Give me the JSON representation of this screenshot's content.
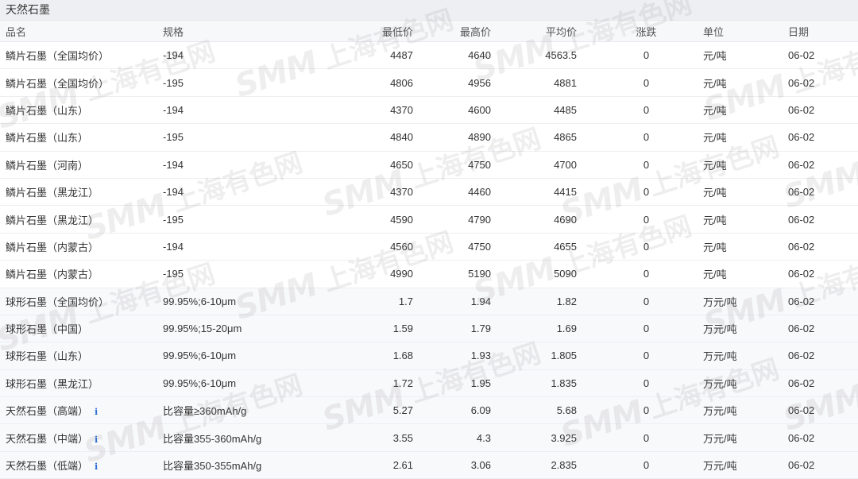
{
  "section": {
    "title": "天然石墨"
  },
  "columns": {
    "name": "品名",
    "spec": "规格",
    "min": "最低价",
    "max": "最高价",
    "avg": "平均价",
    "change": "涨跌",
    "unit": "单位",
    "date": "日期"
  },
  "rows": [
    {
      "name": "鳞片石墨（全国均价）",
      "spec": "-194",
      "min": "4487",
      "max": "4640",
      "avg": "4563.5",
      "change": "0",
      "unit": "元/吨",
      "date": "06-02"
    },
    {
      "name": "鳞片石墨（全国均价）",
      "spec": "-195",
      "min": "4806",
      "max": "4956",
      "avg": "4881",
      "change": "0",
      "unit": "元/吨",
      "date": "06-02"
    },
    {
      "name": "鳞片石墨（山东）",
      "spec": "-194",
      "min": "4370",
      "max": "4600",
      "avg": "4485",
      "change": "0",
      "unit": "元/吨",
      "date": "06-02"
    },
    {
      "name": "鳞片石墨（山东）",
      "spec": "-195",
      "min": "4840",
      "max": "4890",
      "avg": "4865",
      "change": "0",
      "unit": "元/吨",
      "date": "06-02"
    },
    {
      "name": "鳞片石墨（河南）",
      "spec": "-194",
      "min": "4650",
      "max": "4750",
      "avg": "4700",
      "change": "0",
      "unit": "元/吨",
      "date": "06-02"
    },
    {
      "name": "鳞片石墨（黑龙江）",
      "spec": "-194",
      "min": "4370",
      "max": "4460",
      "avg": "4415",
      "change": "0",
      "unit": "元/吨",
      "date": "06-02"
    },
    {
      "name": "鳞片石墨（黑龙江）",
      "spec": "-195",
      "min": "4590",
      "max": "4790",
      "avg": "4690",
      "change": "0",
      "unit": "元/吨",
      "date": "06-02"
    },
    {
      "name": "鳞片石墨（内蒙古）",
      "spec": "-194",
      "min": "4560",
      "max": "4750",
      "avg": "4655",
      "change": "0",
      "unit": "元/吨",
      "date": "06-02"
    },
    {
      "name": "鳞片石墨（内蒙古）",
      "spec": "-195",
      "min": "4990",
      "max": "5190",
      "avg": "5090",
      "change": "0",
      "unit": "元/吨",
      "date": "06-02"
    },
    {
      "name": "球形石墨（全国均价）",
      "spec": "99.95%;6-10μm",
      "min": "1.7",
      "max": "1.94",
      "avg": "1.82",
      "change": "0",
      "unit": "万元/吨",
      "date": "06-02"
    },
    {
      "name": "球形石墨（中国）",
      "spec": "99.95%;15-20μm",
      "min": "1.59",
      "max": "1.79",
      "avg": "1.69",
      "change": "0",
      "unit": "万元/吨",
      "date": "06-02"
    },
    {
      "name": "球形石墨（山东）",
      "spec": "99.95%;6-10μm",
      "min": "1.68",
      "max": "1.93",
      "avg": "1.805",
      "change": "0",
      "unit": "万元/吨",
      "date": "06-02"
    },
    {
      "name": "球形石墨（黑龙江）",
      "spec": "99.95%;6-10μm",
      "min": "1.72",
      "max": "1.95",
      "avg": "1.835",
      "change": "0",
      "unit": "万元/吨",
      "date": "06-02"
    },
    {
      "name": "天然石墨（高端）",
      "info": "i",
      "spec": "比容量≥360mAh/g",
      "min": "5.27",
      "max": "6.09",
      "avg": "5.68",
      "change": "0",
      "unit": "万元/吨",
      "date": "06-02"
    },
    {
      "name": "天然石墨（中端）",
      "info": "i",
      "spec": "比容量355-360mAh/g",
      "min": "3.55",
      "max": "4.3",
      "avg": "3.925",
      "change": "0",
      "unit": "万元/吨",
      "date": "06-02"
    },
    {
      "name": "天然石墨（低端）",
      "info": "i",
      "spec": "比容量350-355mAh/g",
      "min": "2.61",
      "max": "3.06",
      "avg": "2.835",
      "change": "0",
      "unit": "万元/吨",
      "date": "06-02"
    }
  ],
  "watermark": {
    "logo": "SMM",
    "text": "上海有色网"
  }
}
